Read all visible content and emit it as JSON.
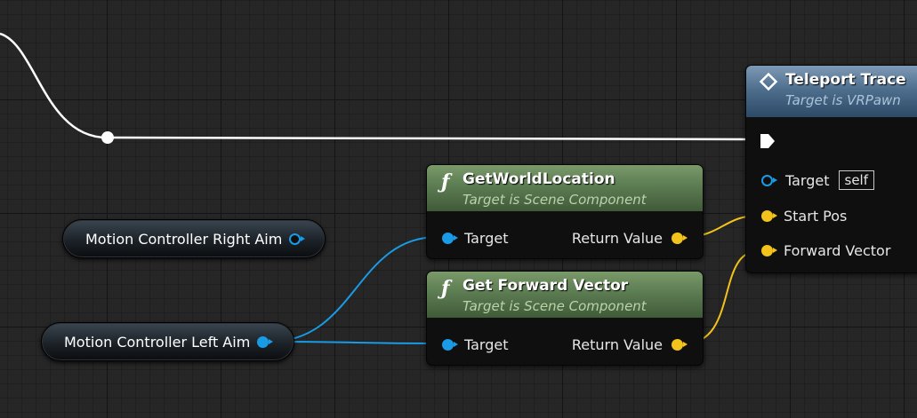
{
  "nodes": {
    "get_world_location": {
      "title": "GetWorldLocation",
      "subtitle": "Target is Scene Component",
      "icon": "function-icon",
      "input_label": "Target",
      "output_label": "Return Value"
    },
    "get_forward_vector": {
      "title": "Get Forward Vector",
      "subtitle": "Target is Scene Component",
      "icon": "function-icon",
      "input_label": "Target",
      "output_label": "Return Value"
    },
    "teleport_trace": {
      "title": "Teleport Trace",
      "subtitle": "Target is VRPawn",
      "icon": "event-diamond-icon",
      "target_label": "Target",
      "target_default": "self",
      "start_pos_label": "Start Pos",
      "forward_vector_label": "Forward Vector"
    }
  },
  "variables": {
    "right_aim": "Motion Controller Right Aim",
    "left_aim": "Motion Controller Left Aim"
  },
  "colors": {
    "object_pin": "#1a9be6",
    "vector_pin": "#f2c31a",
    "exec_wire": "#ffffff",
    "function_header": "#5f7f55",
    "event_header": "#4f6f8e",
    "grid_background": "#262626"
  }
}
